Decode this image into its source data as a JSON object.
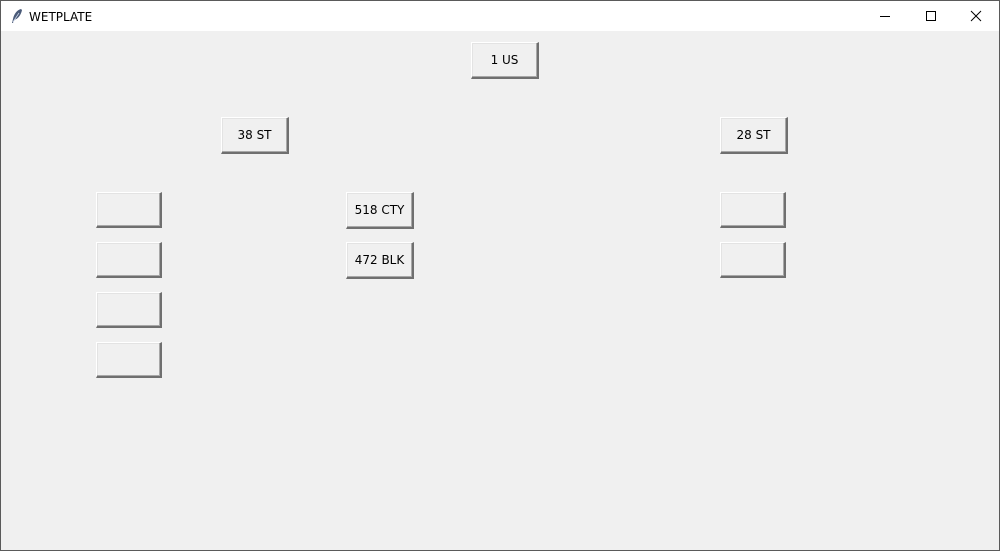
{
  "window": {
    "title": "WETPLATE"
  },
  "icons": {
    "app": "feather-icon",
    "minimize": "minimize-icon",
    "maximize": "maximize-icon",
    "close": "close-icon"
  },
  "buttons": {
    "top": "1 US",
    "left_header": "38 ST",
    "right_header": "28 ST",
    "center_1": "518 CTY",
    "center_2": "472 BLK",
    "left_1": "",
    "left_2": "",
    "left_3": "",
    "left_4": "",
    "right_1": "",
    "right_2": ""
  }
}
